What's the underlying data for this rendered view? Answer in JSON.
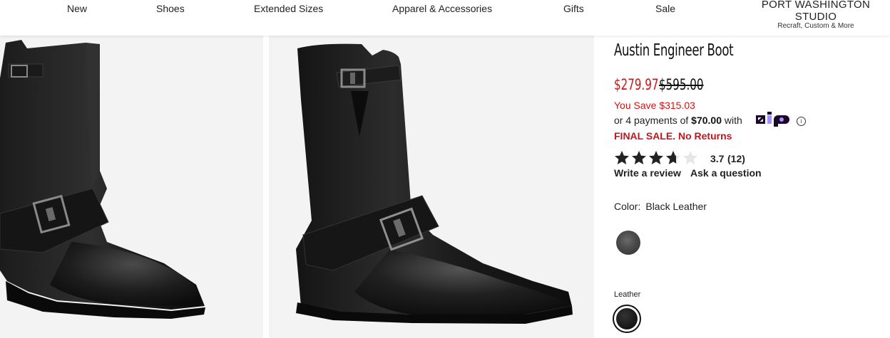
{
  "nav": {
    "items": [
      "New",
      "Shoes",
      "Extended Sizes",
      "Apparel & Accessories",
      "Gifts",
      "Sale"
    ],
    "brand_title": "PORT WASHINGTON STUDIO",
    "brand_subtitle": "Recraft, Custom & More"
  },
  "product": {
    "title": "Austin Engineer Boot",
    "sale_price": "$279.97",
    "original_price": "$595.00",
    "you_save": "You Save $315.03",
    "payments_prefix": "or 4 payments of ",
    "payments_amount": "$70.00",
    "payments_suffix": " with",
    "payments_provider": "zip",
    "final_sale": "FINAL SALE. No Returns",
    "rating": {
      "value": "3.7",
      "count": "(12)",
      "stars_filled": 3.7,
      "stars_max": 5
    },
    "write_review": "Write a review",
    "ask_question": "Ask a question",
    "color_label": "Color:",
    "color_value": "Black Leather",
    "material_label": "Leather"
  },
  "colors": {
    "sale_red": "#d41414",
    "final_sale_red": "#c4161c",
    "zip_purple": "#aa8fff",
    "star": "#222222"
  },
  "icons": {
    "info": "info-icon",
    "star": "star-icon"
  }
}
